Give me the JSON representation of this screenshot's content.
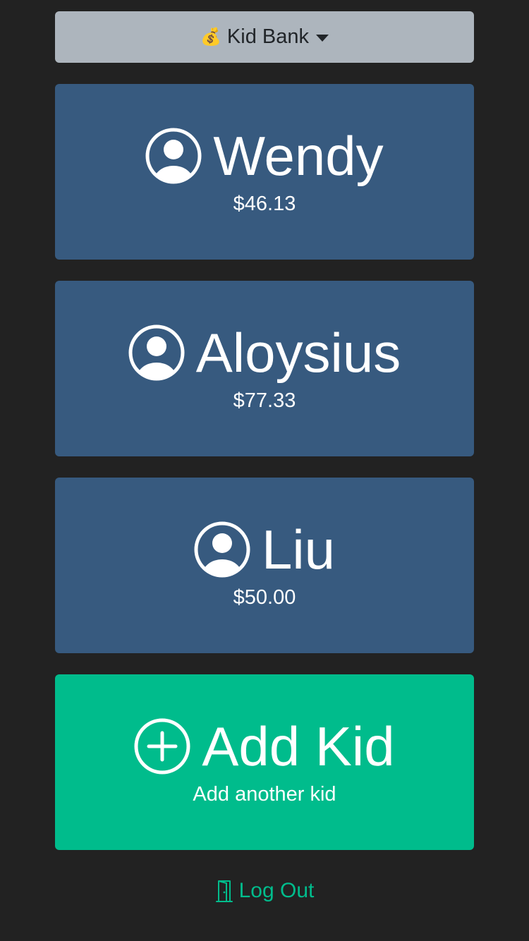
{
  "app_menu": {
    "icon": "money-bag-icon",
    "icon_glyph": "💰",
    "label": "Kid Bank"
  },
  "kids": [
    {
      "name": "Wendy",
      "balance": "$46.13"
    },
    {
      "name": "Aloysius",
      "balance": "$77.33"
    },
    {
      "name": "Liu",
      "balance": "$50.00"
    }
  ],
  "add_kid": {
    "title": "Add Kid",
    "subtitle": "Add another kid"
  },
  "logout": {
    "label": "Log Out",
    "icon": "door-icon"
  },
  "colors": {
    "background": "#222222",
    "menu": "#adb5bd",
    "card": "#375a7f",
    "accent": "#00bc8c"
  }
}
